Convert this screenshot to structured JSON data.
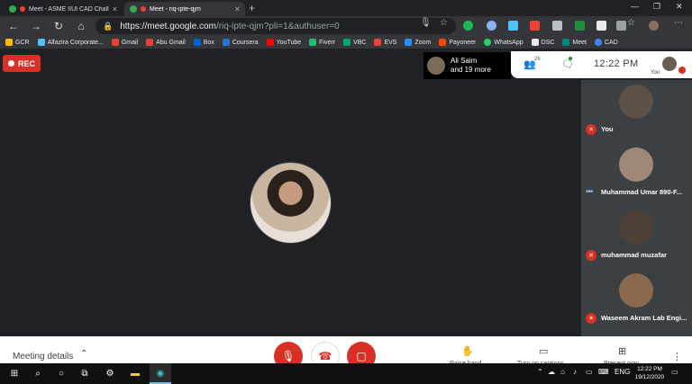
{
  "browser": {
    "tabs": [
      {
        "title": "Meet - ASME IIUI CAD Chall",
        "active": false
      },
      {
        "title": "Meet - riq-ipte-qjm",
        "active": true
      }
    ],
    "url_host": "https://meet.google.com",
    "url_rest": "/riq-ipte-qjm?pli=1&authuser=0",
    "bookmarks": [
      "GCR",
      "Alfazira Corporate...",
      "Gmail",
      "Abu Gmail",
      "Box",
      "Coursera",
      "YouTube",
      "Fiverr",
      "VBC",
      "EVS",
      "Zoom",
      "Payoneer",
      "WhatsApp",
      "DSC",
      "Meet",
      "CAD"
    ]
  },
  "meet": {
    "rec_label": "REC",
    "presenter": {
      "line1": "Ali Saim",
      "line2": "and 19 more"
    },
    "people_count": "26",
    "clock": "12:22 PM",
    "self_label": "You",
    "participants": [
      {
        "name": "You",
        "status": "muted"
      },
      {
        "name": "Muhammad Umar 890-F...",
        "status": "speaking"
      },
      {
        "name": "muhammad muzafar",
        "status": "muted"
      },
      {
        "name": "Waseem Akram Lab Engi...",
        "status": "muted"
      }
    ],
    "bottom": {
      "meeting_details": "Meeting details",
      "raise_hand": "Raise hand",
      "captions": "Turn on captions",
      "present": "Present now"
    }
  },
  "taskbar": {
    "lang": "ENG",
    "time": "12:22 PM",
    "date": "19/12/2020"
  },
  "colors": {
    "meet_bg": "#202124",
    "rec_red": "#d93025",
    "strip_bg": "#3c4043",
    "speaking_blue": "#8ab4f8"
  }
}
